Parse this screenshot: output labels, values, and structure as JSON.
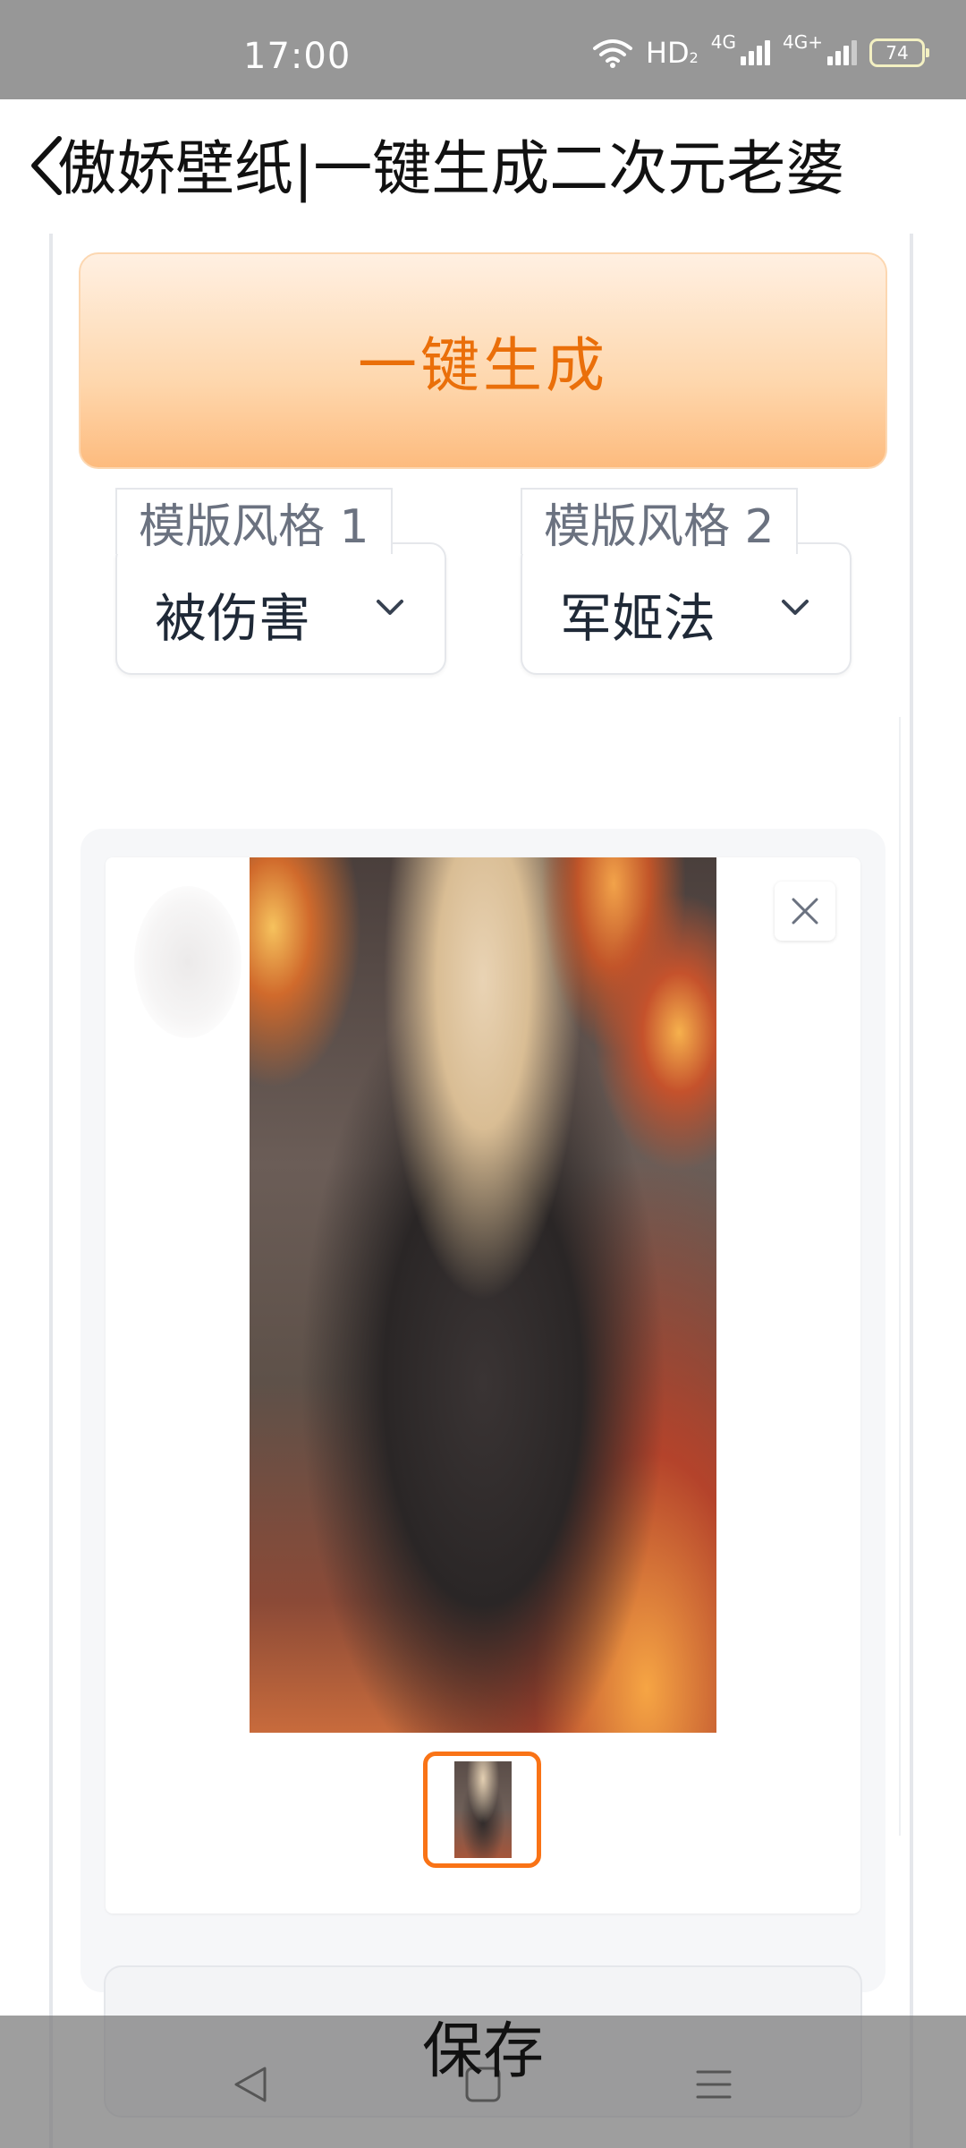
{
  "status_bar": {
    "time": "17:00",
    "network_label": "HD",
    "network_sub": "2",
    "sim1": "4G",
    "sim2": "4G+",
    "battery": "74"
  },
  "header": {
    "title": "傲娇壁纸|一键生成二次元老婆",
    "back_icon": "chevron-left-icon"
  },
  "generate_button": {
    "label": "一键生成"
  },
  "dropdowns": [
    {
      "label": "模版风格 1",
      "value": "被伤害",
      "icon": "chevron-down-icon"
    },
    {
      "label": "模版风格 2",
      "value": "军姬法",
      "icon": "chevron-down-icon"
    }
  ],
  "gallery": {
    "main_image_alt": "anime girl wallpaper",
    "close_icon": "close-icon",
    "thumbnails": 1,
    "selected_index": 0
  },
  "save_button": {
    "label": "保存"
  },
  "nav_bar": {
    "icons": [
      "back-triangle-icon",
      "home-square-icon",
      "menu-lines-icon"
    ]
  },
  "colors": {
    "accent": "#ea6f0a",
    "thumb_border": "#f97316",
    "status_bar_bg": "#979797"
  }
}
